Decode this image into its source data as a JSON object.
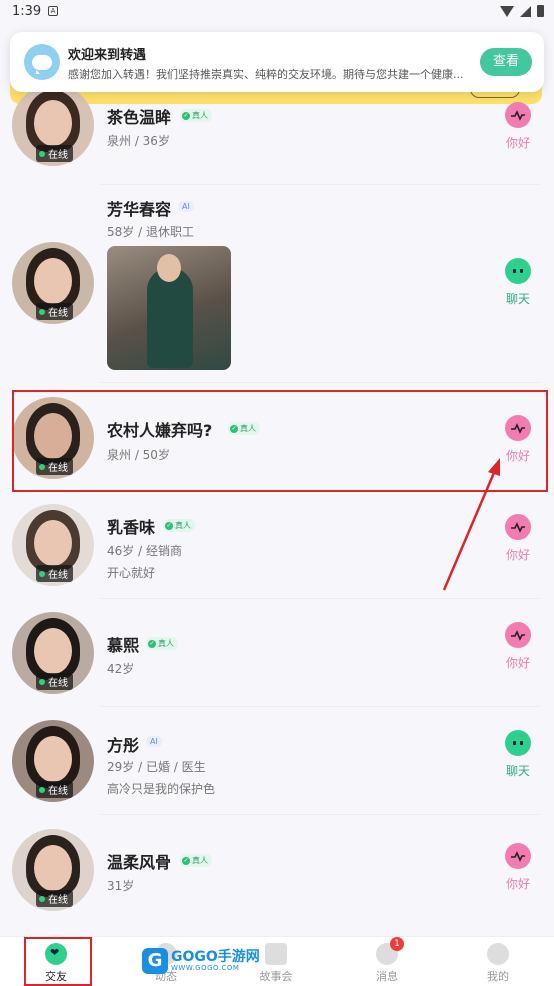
{
  "status_bar": {
    "time": "1:39",
    "notif_glyph": "A"
  },
  "toast": {
    "title": "欢迎来到转遇",
    "body": "感谢您加入转遇！我们坚持推崇真实、纯粹的交友环境。期待与您共建一个健康...",
    "button": "查看"
  },
  "labels": {
    "online": "在线",
    "real": "真人",
    "ai": "AI",
    "hello": "你好",
    "chat": "聊天"
  },
  "users": [
    {
      "name": "茶色温眸",
      "badge": "真人",
      "meta": "泉州 / 36岁",
      "action": "你好"
    },
    {
      "name": "芳华春容",
      "badge": "AI",
      "meta": "58岁 / 退休职工",
      "action": "聊天"
    },
    {
      "name": "农村人嫌弃吗?",
      "badge": "真人",
      "meta": "泉州 / 50岁",
      "action": "你好"
    },
    {
      "name": "乳香味",
      "badge": "真人",
      "meta": "46岁 / 经销商",
      "signature": "开心就好",
      "action": "你好"
    },
    {
      "name": "慕熙",
      "badge": "真人",
      "meta": "42岁",
      "action": "你好"
    },
    {
      "name": "方彤",
      "badge": "AI",
      "meta": "29岁 / 已婚 / 医生",
      "signature": "高冷只是我的保护色",
      "action": "聊天"
    },
    {
      "name": "温柔风骨",
      "badge": "真人",
      "meta": "31岁",
      "action": "你好"
    }
  ],
  "tabs": [
    {
      "label": "交友",
      "active": true
    },
    {
      "label": "动态"
    },
    {
      "label": "故事会"
    },
    {
      "label": "消息",
      "badge": "1"
    },
    {
      "label": "我的"
    }
  ],
  "watermark": {
    "logo": "G",
    "text": "GOGO手游网",
    "url": "WWW.GOGO.COM"
  },
  "colors": {
    "accent": "#2fd08e",
    "heart": "#f27cb0",
    "highlight": "#d9262b"
  }
}
